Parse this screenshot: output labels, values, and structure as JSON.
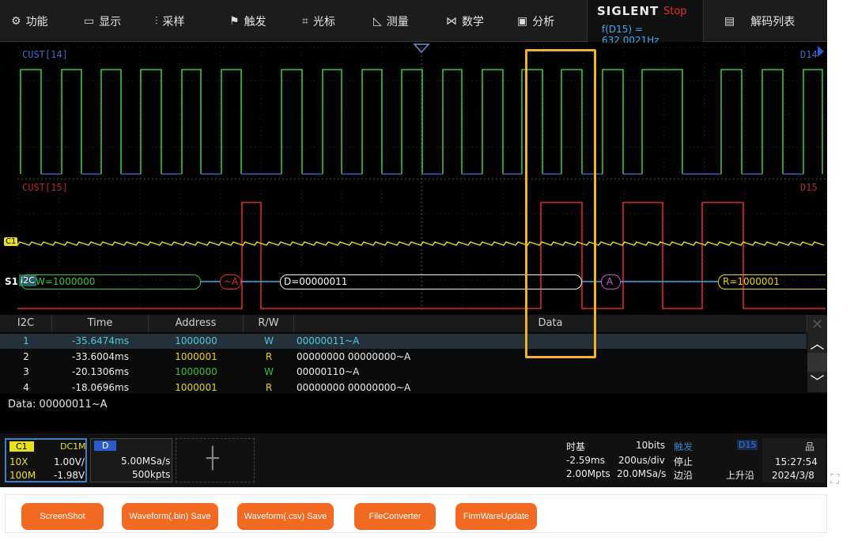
{
  "menu": [
    {
      "icon": "⚙",
      "label": "功能",
      "name": "menu-function"
    },
    {
      "icon": "▭",
      "label": "显示",
      "name": "menu-display"
    },
    {
      "icon": "⫶",
      "label": "采样",
      "name": "menu-acquire"
    },
    {
      "icon": "⚑",
      "label": "触发",
      "name": "menu-trigger"
    },
    {
      "icon": "⌗",
      "label": "光标",
      "name": "menu-cursor"
    },
    {
      "icon": "◺",
      "label": "测量",
      "name": "menu-measure"
    },
    {
      "icon": "⋈",
      "label": "数学",
      "name": "menu-math"
    },
    {
      "icon": "▣",
      "label": "分析",
      "name": "menu-analysis"
    }
  ],
  "brand": {
    "logo": "SIGLENT",
    "state": "Stop",
    "freq": "f(D15) = 632.0021Hz"
  },
  "decode_list": {
    "icon": "▤",
    "label": "解码列表"
  },
  "channels": {
    "d14_label": "CUST[14]",
    "d15_label": "CUST[15]",
    "d14_right": "D14",
    "d15_right": "D15",
    "c1_marker": "C1",
    "s1": "S1",
    "i2c": "I2C"
  },
  "decode_bus": [
    {
      "text": "W=1000000",
      "color": "#39c43c"
    },
    {
      "text": "~A",
      "color": "#e0302a"
    },
    {
      "text": "D=00000011",
      "color": "#ffffff"
    },
    {
      "text": "A",
      "color": "#d34fd1"
    },
    {
      "text": "R=1000001",
      "color": "#e8d51a"
    }
  ],
  "table": {
    "headers": [
      "I2C",
      "Time",
      "Address",
      "R/W",
      "Data"
    ],
    "rows": [
      {
        "idx": "1",
        "time": "-35.6474ms",
        "addr": "1000000",
        "rw": "W",
        "data": "00000011~A",
        "color": "#52c8d8",
        "selected": true
      },
      {
        "idx": "2",
        "time": "-33.6004ms",
        "addr": "1000001",
        "rw": "R",
        "data": "00000000 00000000~A",
        "color": "#e8d51a",
        "selected": false
      },
      {
        "idx": "3",
        "time": "-20.1306ms",
        "addr": "1000000",
        "rw": "W",
        "data": "00000110~A",
        "color": "#39c43c",
        "selected": false
      },
      {
        "idx": "4",
        "time": "-18.0696ms",
        "addr": "1000001",
        "rw": "R",
        "data": "00000000 00000000~A",
        "color": "#e8d51a",
        "selected": false
      }
    ],
    "data_line": "Data:  00000011~A"
  },
  "status": {
    "c1": {
      "name": "C1",
      "coupling": "DC1M",
      "probe": "10X",
      "scale": "1.00V/",
      "bw": "100M",
      "offset": "-1.98V"
    },
    "d": {
      "name": "D",
      "rate": "5.00MSa/s",
      "points": "500kpts"
    },
    "timebase": {
      "title": "时基",
      "bits": "10bits",
      "delay": "-2.59ms",
      "scale": "200us/div",
      "mpts": "2.00Mpts",
      "sa": "20.0MSa/s"
    },
    "trigger": {
      "title": "触发",
      "source": "D15",
      "state": "停止",
      "mode": "边沿",
      "slope": "上升沿"
    },
    "clock": {
      "time": "15:27:54",
      "date": "2024/3/8"
    }
  },
  "buttons": [
    "ScreenShot",
    "Waveform(.bin) Save",
    "Waveform(.csv) Save",
    "FileConverter",
    "FirmWareUpdate"
  ],
  "colors": {
    "d14": "#3cc43c",
    "d15": "#d9282a",
    "c1": "#e8e01f",
    "highlight": "#f0b323",
    "accent": "#f26a21"
  }
}
